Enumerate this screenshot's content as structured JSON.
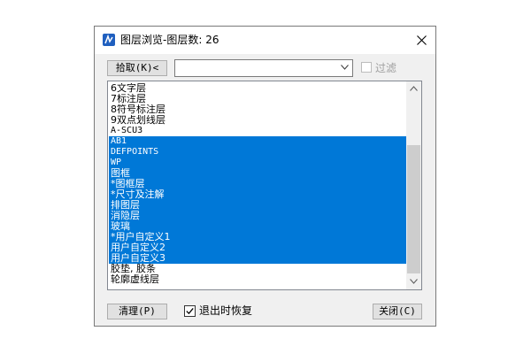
{
  "window": {
    "title": "图层浏览-图层数: 26",
    "close_icon": "close-x-icon"
  },
  "toolbar": {
    "pick_label": "拾取(K)<",
    "combo_value": "",
    "filter_label": "过滤",
    "filter_checked": false
  },
  "layers": [
    {
      "name": "6文字层",
      "selected": false
    },
    {
      "name": "7标注层",
      "selected": false
    },
    {
      "name": "8符号标注层",
      "selected": false
    },
    {
      "name": "9双点划线层",
      "selected": false
    },
    {
      "name": "A-SCU3",
      "selected": false
    },
    {
      "name": "AB1",
      "selected": true
    },
    {
      "name": "DEFPOINTS",
      "selected": true
    },
    {
      "name": "WP",
      "selected": true
    },
    {
      "name": "图框",
      "selected": true
    },
    {
      "name": "*图框层",
      "selected": true
    },
    {
      "name": "*尺寸及注解",
      "selected": true
    },
    {
      "name": "排图层",
      "selected": true
    },
    {
      "name": "消隐层",
      "selected": true
    },
    {
      "name": "玻璃",
      "selected": true
    },
    {
      "name": "*用户自定义1",
      "selected": true
    },
    {
      "name": "用户自定义2",
      "selected": true
    },
    {
      "name": "用户自定义3",
      "selected": true
    },
    {
      "name": "胶垫, 胶条",
      "selected": false
    },
    {
      "name": "轮廓虚线层",
      "selected": false
    }
  ],
  "footer": {
    "clean_label": "清理(P)",
    "exit_restore_label": "退出时恢复",
    "exit_restore_checked": true,
    "close_label": "关闭(C)"
  },
  "colors": {
    "selection": "#0078d7",
    "dialog_bg": "#f0f0f0"
  }
}
